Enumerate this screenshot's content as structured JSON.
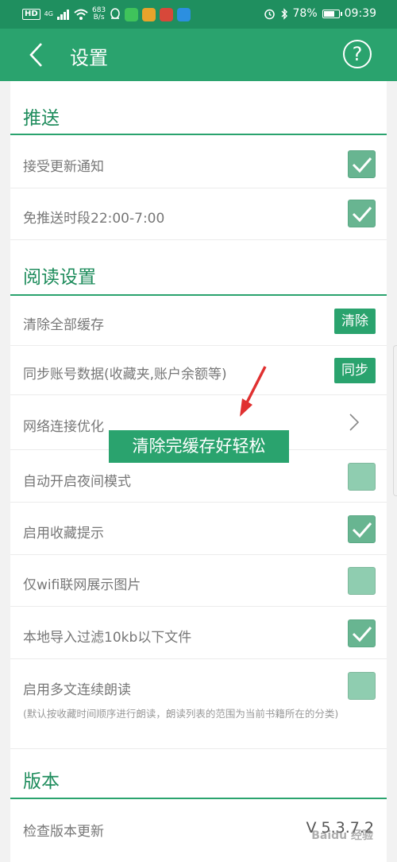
{
  "status_bar": {
    "network_tag": "HD",
    "network_gen": "4G",
    "speed_value": "683",
    "speed_unit": "B/s",
    "battery_percent": "78%",
    "time": "09:39",
    "battery_level": 0.78
  },
  "app_bar": {
    "title": "设置",
    "help_symbol": "?"
  },
  "sections": {
    "push": {
      "title": "推送",
      "items": [
        {
          "label": "接受更新通知",
          "checked": true
        },
        {
          "label": "免推送时段22:00-7:00",
          "checked": true
        }
      ]
    },
    "reading": {
      "title": "阅读设置",
      "clear_cache": {
        "label": "清除全部缓存",
        "button": "清除"
      },
      "sync_account": {
        "label": "同步账号数据(收藏夹,账户余额等)",
        "button": "同步"
      },
      "network_optimize": {
        "label": "网络连接优化"
      },
      "night_mode": {
        "label": "自动开启夜间模式",
        "checked": false
      },
      "favorite_tip": {
        "label": "启用收藏提示",
        "checked": true
      },
      "wifi_images": {
        "label": "仅wifi联网展示图片",
        "checked": false
      },
      "import_filter": {
        "label": "本地导入过滤10kb以下文件",
        "checked": true
      },
      "continuous_read": {
        "label": "启用多文连续朗读",
        "checked": false,
        "note": "(默认按收藏时间顺序进行朗读，朗读列表的范围为当前书籍所在的分类)"
      }
    },
    "version": {
      "title": "版本",
      "check_update": {
        "label": "检查版本更新",
        "value": "V 5.3.7.2"
      }
    }
  },
  "tooltip": "清除完缓存好轻松",
  "watermark": "Baidu 经验",
  "colors": {
    "primary": "#2aa36e",
    "status_bar": "#1f8f5f",
    "section_title": "#1e8c5c",
    "checkbox_checked": "#68b591",
    "checkbox_unchecked": "#8fcdb0",
    "annotation_arrow": "#e03030"
  },
  "icons": {
    "back": "chevron-left-icon",
    "help": "question-circle-icon",
    "check": "checkmark-icon",
    "forward": "chevron-right-icon",
    "status": [
      "signal-icon",
      "wifi-icon",
      "alarm-icon",
      "bluetooth-icon",
      "battery-icon"
    ]
  }
}
